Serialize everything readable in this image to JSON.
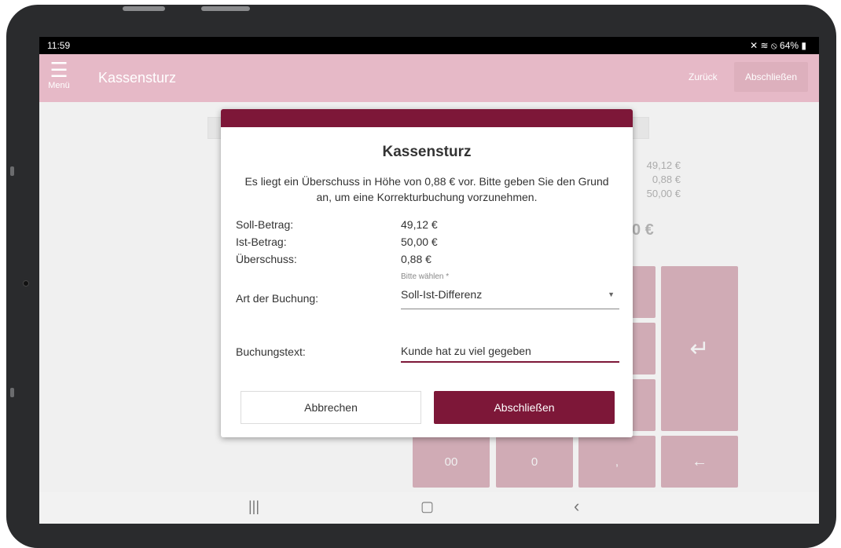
{
  "status_bar": {
    "time": "11:59",
    "icons": "✕ ≋ ⦸",
    "battery": "64%"
  },
  "app_bar": {
    "menu_label": "Menü",
    "title": "Kassensturz",
    "back_label": "Zurück",
    "finish_label": "Abschließen"
  },
  "background_amounts": {
    "soll": "49,12 €",
    "diff": "0,88 €",
    "ist": "50,00 €",
    "total_partial": "0 €"
  },
  "keypad": {
    "double_zero": "00",
    "zero": "0",
    "comma": ",",
    "enter_icon": "↵",
    "backspace_icon": "←"
  },
  "dialog": {
    "title": "Kassensturz",
    "message": "Es liegt ein Überschuss in Höhe von 0,88 € vor. Bitte geben Sie den Grund an, um eine Korrekturbuchung vorzunehmen.",
    "rows": [
      {
        "label": "Soll-Betrag:",
        "value": "49,12 €"
      },
      {
        "label": "Ist-Betrag:",
        "value": "50,00 €"
      },
      {
        "label": "Überschuss:",
        "value": "0,88 €"
      }
    ],
    "booking_type_label": "Art der Buchung:",
    "booking_type_hint": "Bitte wählen *",
    "booking_type_value": "Soll-Ist-Differenz",
    "booking_text_label": "Buchungstext:",
    "booking_text_value": "Kunde hat zu viel gegeben",
    "cancel_label": "Abbrechen",
    "confirm_label": "Abschließen"
  },
  "nav_bar": {
    "recents_icon": "|||",
    "home_icon": "▢",
    "back_icon": "‹"
  },
  "colors": {
    "brand": "#7d1738",
    "app_bar": "#e6b9c7",
    "keypad": "#ddb6c1"
  }
}
